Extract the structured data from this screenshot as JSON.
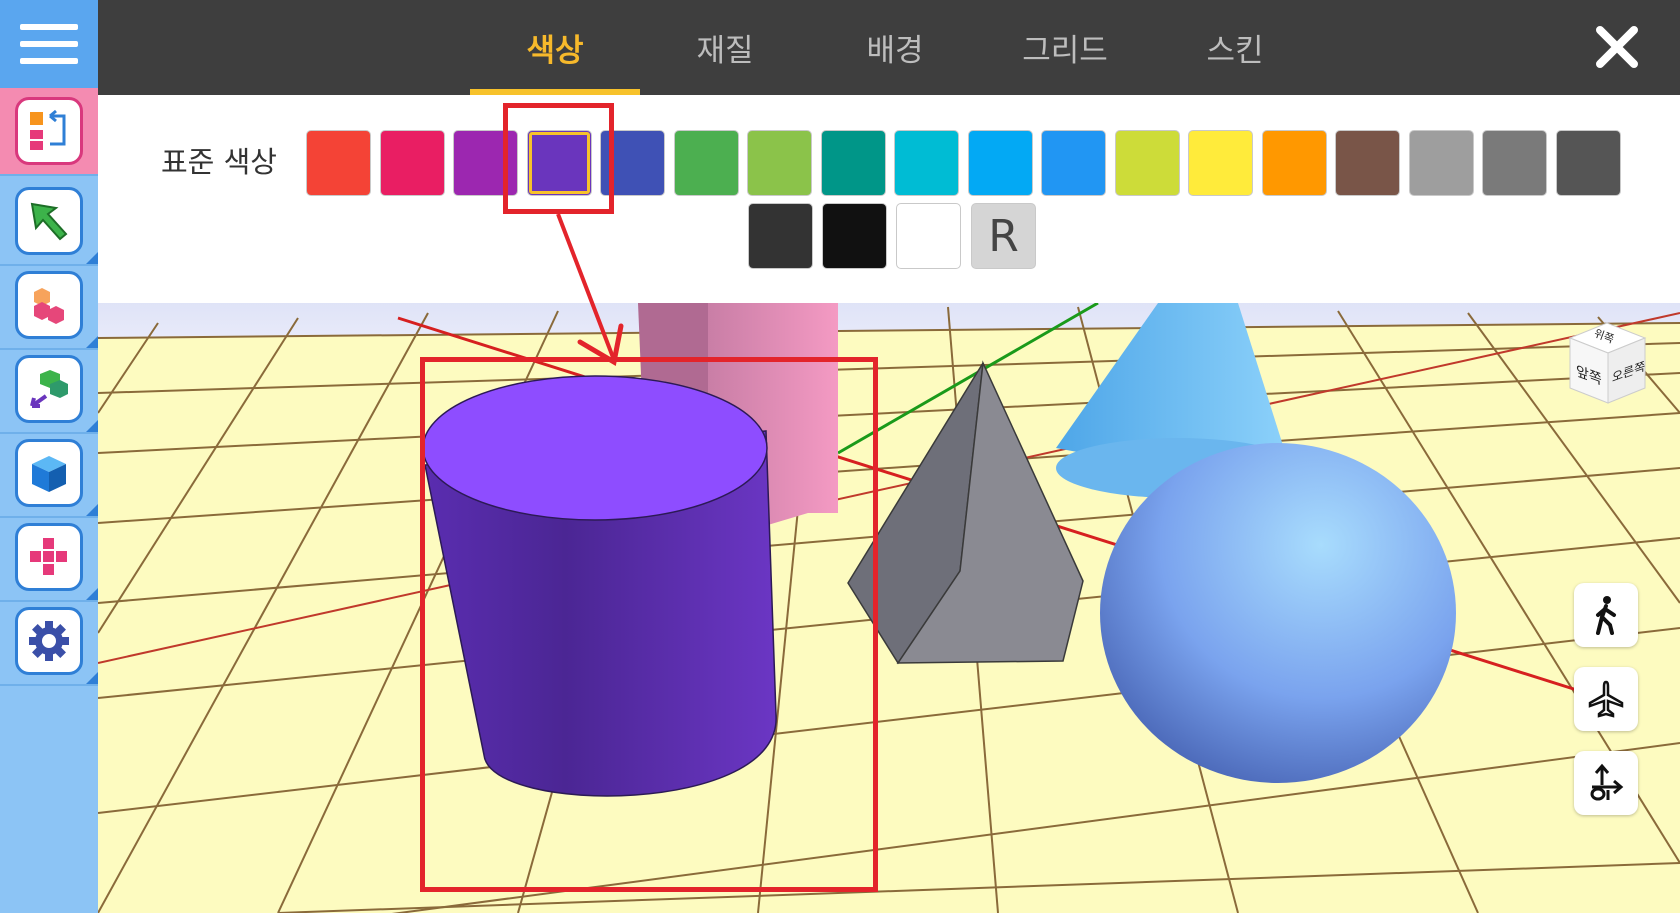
{
  "tabs": [
    {
      "label": "색상",
      "active": true
    },
    {
      "label": "재질",
      "active": false
    },
    {
      "label": "배경",
      "active": false
    },
    {
      "label": "그리드",
      "active": false
    },
    {
      "label": "스킨",
      "active": false
    }
  ],
  "palette": {
    "label": "표준 색상",
    "colors_row1": [
      "#f44336",
      "#e91e63",
      "#9c27b0",
      "#6a35bd",
      "#3f51b5",
      "#4caf50",
      "#8bc34a",
      "#009688",
      "#00bcd4",
      "#03a9f4",
      "#2196f3",
      "#cddc39",
      "#ffeb3b",
      "#ff9800",
      "#795548",
      "#9e9e9e",
      "#7a7a7a",
      "#555555"
    ],
    "colors_row2": [
      "#333333",
      "#111111",
      "#ffffff"
    ],
    "reset_label": "R",
    "selected_color": "#6a35bd"
  },
  "view_cube": {
    "top_label": "위쪽",
    "front_label": "앞쪽",
    "right_label": "오른쪽"
  },
  "navigation_modes": [
    {
      "icon": "walk-icon"
    },
    {
      "icon": "airplane-icon"
    },
    {
      "icon": "orbit-arrow-icon"
    }
  ],
  "sidebar_tools": [
    {
      "icon": "swap-shapes-icon",
      "active": true
    },
    {
      "icon": "select-arrow-icon",
      "active": false
    },
    {
      "icon": "stacked-cubes-icon",
      "active": false
    },
    {
      "icon": "move-cubes-icon",
      "active": false
    },
    {
      "icon": "cube-icon",
      "active": false
    },
    {
      "icon": "cube-net-icon",
      "active": false
    },
    {
      "icon": "gear-icon",
      "active": false
    }
  ],
  "colors": {
    "accent": "#f7c22b",
    "annotation_red": "#e3242b",
    "topbar": "#3e3e3e",
    "sidebar": "#8cc4f5"
  }
}
